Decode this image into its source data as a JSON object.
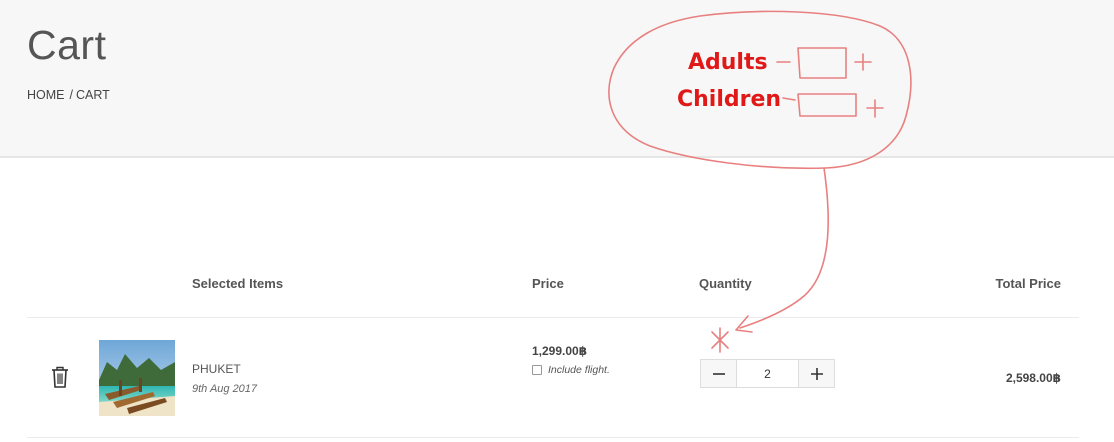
{
  "header": {
    "title": "Cart",
    "breadcrumb": {
      "home": "HOME",
      "separator": "/",
      "current": "CART"
    }
  },
  "table": {
    "columns": {
      "items": "Selected Items",
      "price": "Price",
      "quantity": "Quantity",
      "total": "Total Price"
    },
    "rows": [
      {
        "name": "PHUKET",
        "date": "9th Aug 2017",
        "price": "1,299.00฿",
        "include_flight_label": "Include flight.",
        "include_flight_checked": false,
        "quantity": "2",
        "total": "2,598.00฿",
        "icons": {
          "delete": "trash-icon",
          "decrease": "minus-icon",
          "increase": "plus-icon"
        }
      }
    ]
  },
  "annotation": {
    "adults_label": "Adults",
    "children_label": "Children",
    "sketch_minus": "−",
    "sketch_plus": "+",
    "color": "#e01818"
  }
}
